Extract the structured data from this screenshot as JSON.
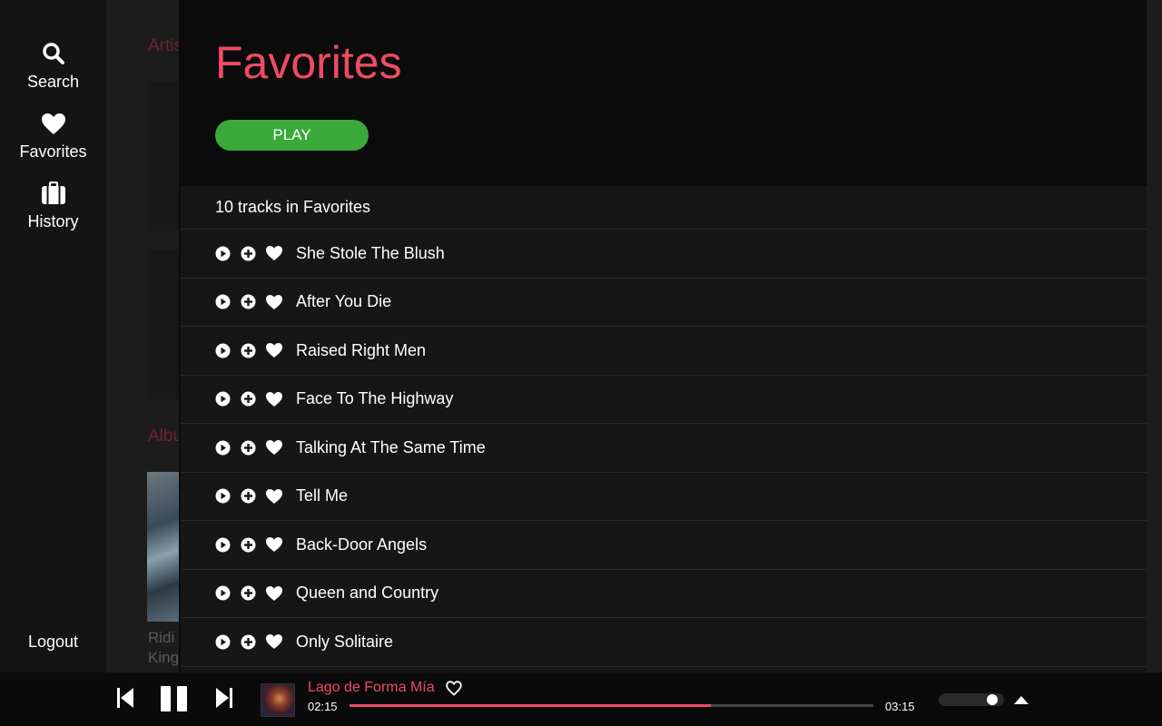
{
  "sidebar": {
    "items": [
      {
        "label": "Search",
        "icon": "search-icon"
      },
      {
        "label": "Favorites",
        "icon": "heart-icon"
      },
      {
        "label": "History",
        "icon": "briefcase-icon"
      }
    ],
    "logout_label": "Logout"
  },
  "background": {
    "artists_heading": "Artis",
    "albums_heading": "Albu",
    "album_title_line1": "Ridi",
    "album_title_line2": "King"
  },
  "favorites": {
    "title": "Favorites",
    "play_label": "PLAY",
    "track_count_text": "10 tracks in Favorites",
    "tracks": [
      {
        "title": "She Stole The Blush"
      },
      {
        "title": "After You Die"
      },
      {
        "title": "Raised Right Men"
      },
      {
        "title": "Face To The Highway"
      },
      {
        "title": "Talking At The Same Time"
      },
      {
        "title": "Tell Me"
      },
      {
        "title": "Back-Door Angels"
      },
      {
        "title": "Queen and Country"
      },
      {
        "title": "Only Solitaire"
      }
    ]
  },
  "player": {
    "now_playing_title": "Lago de Forma Mía",
    "current_time": "02:15",
    "total_time": "03:15",
    "progress_fraction": 0.69,
    "volume_fraction": 0.88
  },
  "colors": {
    "accent": "#ee4b63",
    "play_button": "#3aa93a",
    "panel_bg": "#0b0b0b",
    "tracklist_bg": "#161617"
  }
}
